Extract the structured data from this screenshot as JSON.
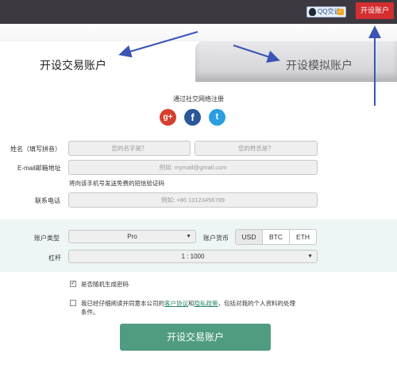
{
  "topbar": {
    "qq_login_label": "QQ交谈",
    "open_account_label": "开设账户"
  },
  "tabs": {
    "real": "开设交易账户",
    "demo": "开设模拟账户"
  },
  "social": {
    "title": "通过社交网络注册",
    "google": "g+",
    "facebook": "f",
    "twitter": "t"
  },
  "form": {
    "name_label": "姓名（填写拼音）",
    "first_name_placeholder": "您的名字是？",
    "last_name_placeholder": "您的姓氏是？",
    "email_label": "E-mail邮箱地址",
    "email_placeholder": "例如: mymail@gmail.com",
    "sms_hint": "将向该手机号发送免费的短信验证码",
    "phone_label": "联系电话",
    "phone_placeholder": "例如: +86 13123456789",
    "account_type_label": "账户类型",
    "account_type_value": "Pro",
    "currency_label": "账户货币",
    "currencies": [
      "USD",
      "BTC",
      "ETH"
    ],
    "selected_currency": "USD",
    "leverage_label": "杠杆",
    "leverage_value": "1 : 1000",
    "random_password_label": "是否随机生成密码",
    "agree_prefix": "我已经仔细阅读并同意本公司的",
    "agree_link1": "客户协议",
    "agree_and": "和",
    "agree_link2": "隐私政策",
    "agree_suffix": "，包括对我的个人资料的处理条件。",
    "submit_label": "开设交易账户"
  },
  "colors": {
    "topbar": "#3d3940",
    "open_button": "#d32f30",
    "submit": "#4f9c80",
    "arrow": "#3b55b5",
    "band": "#eef6f5"
  }
}
